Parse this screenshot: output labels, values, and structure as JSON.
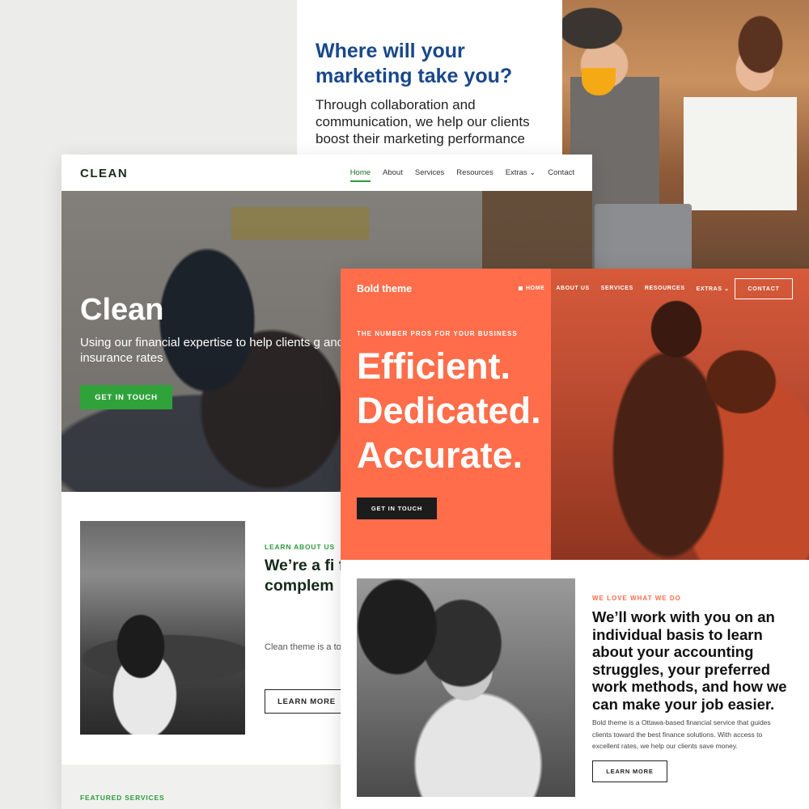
{
  "marketing": {
    "heading": "Where will your marketing take you?",
    "subtext": "Through collaboration and communication, we help our clients boost their marketing performance"
  },
  "clean": {
    "logo": "CLEAN",
    "nav": [
      "Home",
      "About",
      "Services",
      "Resources",
      "Extras ⌄",
      "Contact"
    ],
    "hero_title": "Clean",
    "hero_text": "Using our financial expertise to help clients g and insurance rates",
    "cta": "GET IN TOUCH",
    "about_eyebrow": "LEARN ABOUT US",
    "about_heading": "We’re a fi financial clients fi complem",
    "about_body": "Clean theme is a toward the best fi help our clients sa",
    "learn_more": "LEARN MORE",
    "featured": "FEATURED SERVICES"
  },
  "bold": {
    "logo": "Bold theme",
    "nav": [
      "HOME",
      "ABOUT US",
      "SERVICES",
      "RESOURCES",
      "EXTRAS ⌄"
    ],
    "contact": "CONTACT",
    "eyebrow": "THE NUMBER PROS FOR YOUR BUSINESS",
    "headline": [
      "Efficient.",
      "Dedicated.",
      "Accurate."
    ],
    "cta": "GET IN TOUCH",
    "section_eyebrow": "WE LOVE WHAT WE DO",
    "section_heading": "We’ll work with you on an individual basis to learn about your accounting struggles, your preferred work methods, and how we can make your job easier.",
    "section_body": "Bold theme is a Ottawa-based financial service that guides clients toward the best finance solutions. With access to excellent rates, we help our clients save money.",
    "learn_more": "LEARN MORE"
  },
  "colors": {
    "clean_accent": "#2fa33a",
    "bold_accent": "#ff6d4a",
    "marketing_heading": "#19478a"
  }
}
